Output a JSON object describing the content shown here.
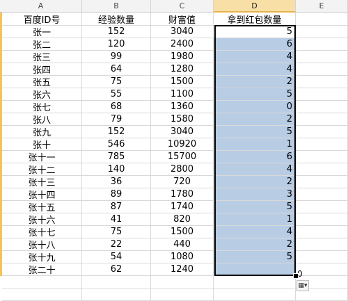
{
  "columns": {
    "A": "A",
    "B": "B",
    "C": "C",
    "D": "D",
    "E": "E"
  },
  "headers": {
    "a": "百度ID号",
    "b": "经验数量",
    "c": "财富值",
    "d": "拿到红包数量"
  },
  "rows": [
    {
      "id": "张一",
      "exp": "152",
      "wealth": "3040",
      "count": "5"
    },
    {
      "id": "张二",
      "exp": "120",
      "wealth": "2400",
      "count": "6"
    },
    {
      "id": "张三",
      "exp": "99",
      "wealth": "1980",
      "count": "4"
    },
    {
      "id": "张四",
      "exp": "64",
      "wealth": "1280",
      "count": "4"
    },
    {
      "id": "张五",
      "exp": "75",
      "wealth": "1500",
      "count": "2"
    },
    {
      "id": "张六",
      "exp": "55",
      "wealth": "1100",
      "count": "5"
    },
    {
      "id": "张七",
      "exp": "68",
      "wealth": "1360",
      "count": "0"
    },
    {
      "id": "张八",
      "exp": "79",
      "wealth": "1580",
      "count": "2"
    },
    {
      "id": "张九",
      "exp": "152",
      "wealth": "3040",
      "count": "5"
    },
    {
      "id": "张十",
      "exp": "546",
      "wealth": "10920",
      "count": "1"
    },
    {
      "id": "张十一",
      "exp": "785",
      "wealth": "15700",
      "count": "6"
    },
    {
      "id": "张十二",
      "exp": "140",
      "wealth": "2800",
      "count": "4"
    },
    {
      "id": "张十三",
      "exp": "36",
      "wealth": "720",
      "count": "2"
    },
    {
      "id": "张十四",
      "exp": "89",
      "wealth": "1780",
      "count": "3"
    },
    {
      "id": "张十五",
      "exp": "87",
      "wealth": "1740",
      "count": "5"
    },
    {
      "id": "张十六",
      "exp": "41",
      "wealth": "820",
      "count": "1"
    },
    {
      "id": "张十七",
      "exp": "75",
      "wealth": "1500",
      "count": "4"
    },
    {
      "id": "张十八",
      "exp": "22",
      "wealth": "440",
      "count": "2"
    },
    {
      "id": "张十九",
      "exp": "54",
      "wealth": "1080",
      "count": "5"
    },
    {
      "id": "张二十",
      "exp": "62",
      "wealth": "1240",
      "count": ""
    }
  ],
  "overflow_value": "0",
  "autofill_icon": "autofill-options-icon",
  "colors": {
    "selection": "#b8cce4",
    "header_selected": "#f7dfa6",
    "row_edge": "#f2c45b"
  }
}
